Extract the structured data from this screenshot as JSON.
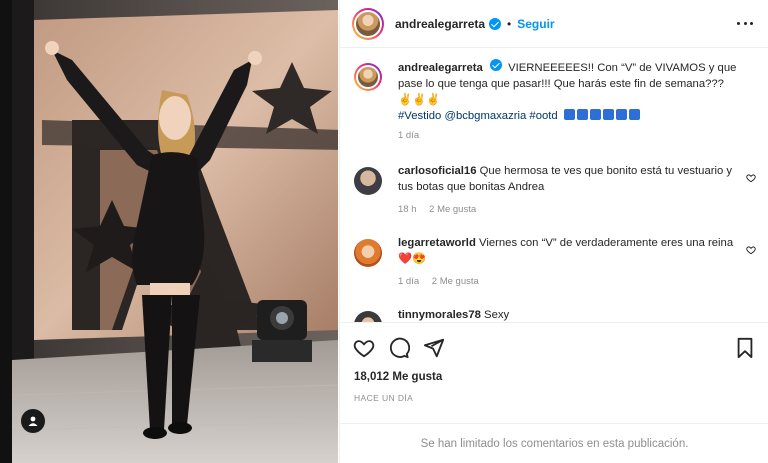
{
  "post_author": {
    "username": "andrealegarreta",
    "verified": true,
    "follow_label": "Seguir",
    "separator": "•"
  },
  "caption": {
    "username": "andrealegarreta",
    "text": "VIERNEEEEES!! Con “V” de VIVAMOS y que pase lo que tenga que pasar!!! Que harás este fin de semana???",
    "emojis": "✌️✌️✌️",
    "tags_text": "#Vestido @bcbgmaxazria #ootd",
    "time": "1 día"
  },
  "comments": [
    {
      "username": "carlosoficial16",
      "text": "Que hermosa te ves que bonito está tu vestuario y tus botas que bonitas Andrea",
      "time": "18 h",
      "likes": "2 Me gusta"
    },
    {
      "username": "legarretaworld",
      "text": "Viernes con “V” de verdaderamente eres una reina",
      "emojis": "❤️😍",
      "time": "1 día",
      "likes": "2 Me gusta"
    },
    {
      "username": "tinnymorales78",
      "text": "Sexy"
    }
  ],
  "engagement": {
    "likes_count": "18,012 Me gusta",
    "posted_ago": "HACE UN DÍA"
  },
  "footer": {
    "comments_limited": "Se han limitado los comentarios en esta publicación."
  },
  "colors": {
    "link_blue": "#0095f6",
    "hashtag_blue": "#00376b",
    "muted_gray": "#8e8e8e",
    "text_dark": "#262626",
    "heart_red": "#ed4956"
  },
  "icons": [
    "heart-icon",
    "comment-icon",
    "share-icon",
    "bookmark-icon",
    "more-options-icon",
    "verified-icon",
    "tag-user-icon"
  ]
}
